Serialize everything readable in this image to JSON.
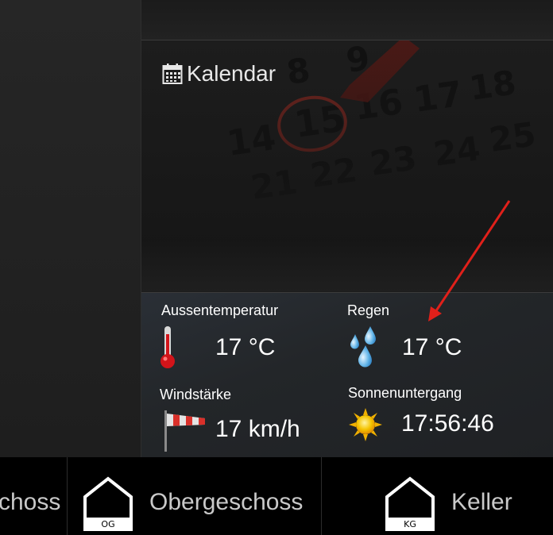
{
  "calendar": {
    "title": "Kalendar",
    "background_numbers": [
      "8",
      "9",
      "15",
      "16",
      "17",
      "18",
      "14",
      "23",
      "24",
      "25",
      "21",
      "22"
    ],
    "highlight_color": "#c0392b"
  },
  "weather": {
    "outdoor_temp_label": "Aussentemperatur",
    "outdoor_temp_value": "17 °C",
    "rain_label": "Regen",
    "rain_value": "17 °C",
    "wind_label": "Windstärke",
    "wind_value": "17 km/h",
    "sunset_label": "Sonnenuntergang",
    "sunset_value": "17:56:46"
  },
  "annotation": {
    "arrow_color": "#e0201a"
  },
  "bottom_nav": {
    "items": [
      {
        "label": "choss"
      },
      {
        "label": "Obergeschoss",
        "icon_text": "OG"
      },
      {
        "label": "Keller",
        "icon_text": "KG"
      }
    ]
  },
  "icons": [
    "calendar-icon",
    "thermometer-icon",
    "rain-drops-icon",
    "windsock-icon",
    "sun-icon",
    "house-og-icon",
    "house-kg-icon"
  ]
}
